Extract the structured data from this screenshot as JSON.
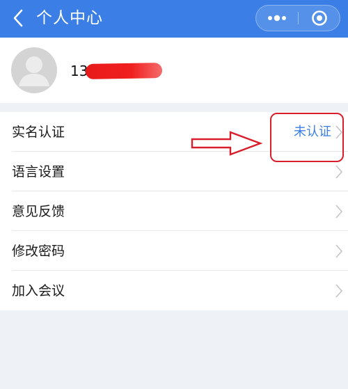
{
  "header": {
    "title": "个人中心",
    "background_color": "#3a7ee6",
    "back_icon": "chevron-left-icon",
    "more_icon": "more-dots-icon",
    "close_icon": "target-close-icon"
  },
  "profile": {
    "phone_prefix": "13",
    "avatar_icon": "default-user-avatar-icon"
  },
  "menu": {
    "items": [
      {
        "label": "实名认证",
        "value": "未认证"
      },
      {
        "label": "语言设置"
      },
      {
        "label": "意见反馈"
      },
      {
        "label": "修改密码"
      },
      {
        "label": "加入会议"
      }
    ],
    "value_color": "#3a7ee6",
    "chevron_icon": "chevron-right-icon"
  },
  "annotation": {
    "color": "#d81e2a"
  }
}
